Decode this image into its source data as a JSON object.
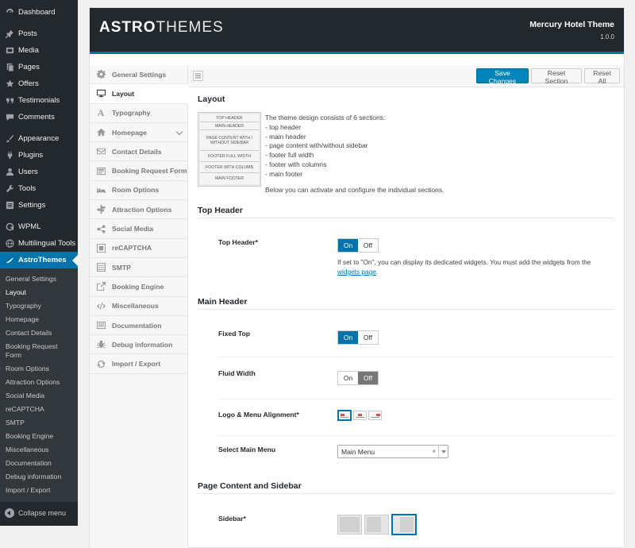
{
  "wp_menu": {
    "items": [
      {
        "label": "Dashboard",
        "icon": "dashboard-icon"
      },
      {
        "label": "Posts",
        "icon": "pin-icon"
      },
      {
        "label": "Media",
        "icon": "media-icon"
      },
      {
        "label": "Pages",
        "icon": "pages-icon"
      },
      {
        "label": "Offers",
        "icon": "star-icon"
      },
      {
        "label": "Testimonials",
        "icon": "quote-icon"
      },
      {
        "label": "Comments",
        "icon": "comment-icon"
      },
      {
        "label": "Appearance",
        "icon": "brush-icon"
      },
      {
        "label": "Plugins",
        "icon": "plug-icon"
      },
      {
        "label": "Users",
        "icon": "user-icon"
      },
      {
        "label": "Tools",
        "icon": "wrench-icon"
      },
      {
        "label": "Settings",
        "icon": "settings-icon"
      },
      {
        "label": "WPML",
        "icon": "wpml-icon"
      },
      {
        "label": "Multilingual Tools",
        "icon": "globe-icon"
      },
      {
        "label": "AstroThemes",
        "icon": "astro-icon"
      }
    ],
    "submenu": [
      "General Settings",
      "Layout",
      "Typography",
      "Homepage",
      "Contact Details",
      "Booking Request Form",
      "Room Options",
      "Attraction Options",
      "Social Media",
      "reCAPTCHA",
      "SMTP",
      "Booking Engine",
      "Miscellaneous",
      "Documentation",
      "Debug information",
      "Import / Export"
    ],
    "collapse_label": "Collapse menu"
  },
  "brand": {
    "logo_bold": "ASTRO",
    "logo_light": "THEMES",
    "theme_name": "Mercury Hotel Theme",
    "version": "1.0.0"
  },
  "nav": {
    "items": [
      {
        "label": "General Settings",
        "icon": "gear-icon"
      },
      {
        "label": "Layout",
        "icon": "monitor-icon"
      },
      {
        "label": "Typography",
        "icon": "font-icon"
      },
      {
        "label": "Homepage",
        "icon": "home-icon"
      },
      {
        "label": "Contact Details",
        "icon": "envelope-icon"
      },
      {
        "label": "Booking Request Form",
        "icon": "form-icon"
      },
      {
        "label": "Room Options",
        "icon": "bed-icon"
      },
      {
        "label": "Attraction Options",
        "icon": "signpost-icon"
      },
      {
        "label": "Social Media",
        "icon": "share-icon"
      },
      {
        "label": "reCAPTCHA",
        "icon": "captcha-icon"
      },
      {
        "label": "SMTP",
        "icon": "server-icon"
      },
      {
        "label": "Booking Engine",
        "icon": "external-link-icon"
      },
      {
        "label": "Miscellaneous",
        "icon": "code-icon"
      },
      {
        "label": "Documentation",
        "icon": "document-icon"
      },
      {
        "label": "Debug information",
        "icon": "bug-icon"
      },
      {
        "label": "Import / Export",
        "icon": "refresh-icon"
      }
    ]
  },
  "toolbar": {
    "save_label": "Save Changes",
    "reset_section_label": "Reset Section",
    "reset_all_label": "Reset All"
  },
  "layout": {
    "title": "Layout",
    "diagram": [
      "TOP HEADER",
      "MAIN HEADER",
      "PAGE CONTENT WITH / WITHOUT SIDEBAR",
      "FOOTER FULL WIDTH",
      "FOOTER WITH COLUMB",
      "MAIN FOOTER"
    ],
    "intro": "The theme design consists of 6 sections:",
    "sections": [
      "- top header",
      "- main header",
      "- page content with/without sidebar",
      "- footer full width",
      "- footer with columns",
      "- main footer"
    ],
    "outro": "Below you can activate and configure the individual sections."
  },
  "top_header": {
    "title": "Top Header",
    "field_label": "Top Header*",
    "on": "On",
    "off": "Off",
    "help_text": "If set to \"On\", you can display its dedicated widgets. You must add the widgets from the",
    "help_link": "widgets page",
    "help_end": "."
  },
  "main_header": {
    "title": "Main Header",
    "fixed_top_label": "Fixed Top",
    "fluid_width_label": "Fluid Width",
    "logo_alignment_label": "Logo & Menu Alignment*",
    "select_menu_label": "Select Main Menu",
    "select_menu_value": "Main Menu",
    "clear_symbol": "×",
    "on": "On",
    "off": "Off"
  },
  "page_content": {
    "title": "Page Content and Sidebar",
    "sidebar_label": "Sidebar*"
  }
}
